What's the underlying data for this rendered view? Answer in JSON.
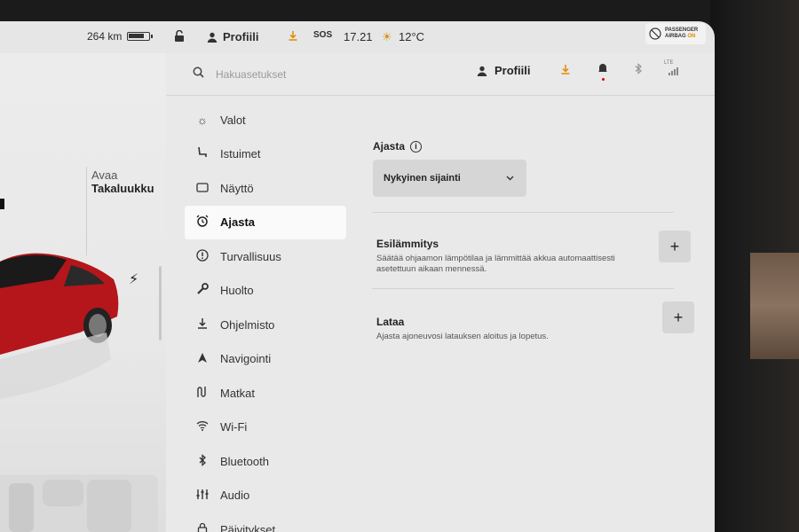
{
  "status_bar": {
    "range": "264 km",
    "profile": "Profiili",
    "sos": "SOS",
    "time": "17.21",
    "temperature": "12°C",
    "airbag_line1": "PASSENGER",
    "airbag_line2": "AIRBAG",
    "airbag_state": "ON"
  },
  "car_panel": {
    "trunk_open": "Avaa",
    "trunk_label": "Takaluukku"
  },
  "settings": {
    "search_placeholder": "Hakuasetukset",
    "header_profile": "Profiili",
    "lte": "LTE",
    "menu": [
      {
        "label": "Valot",
        "icon": "light-icon"
      },
      {
        "label": "Istuimet",
        "icon": "seat-icon"
      },
      {
        "label": "Näyttö",
        "icon": "display-icon"
      },
      {
        "label": "Ajasta",
        "icon": "alarm-clock-icon"
      },
      {
        "label": "Turvallisuus",
        "icon": "warning-circle-icon"
      },
      {
        "label": "Huolto",
        "icon": "wrench-icon"
      },
      {
        "label": "Ohjelmisto",
        "icon": "download-icon"
      },
      {
        "label": "Navigointi",
        "icon": "navigation-arrow-icon"
      },
      {
        "label": "Matkat",
        "icon": "trips-icon"
      },
      {
        "label": "Wi-Fi",
        "icon": "wifi-icon"
      },
      {
        "label": "Bluetooth",
        "icon": "bluetooth-icon"
      },
      {
        "label": "Audio",
        "icon": "equalizer-icon"
      },
      {
        "label": "Päivitykset",
        "icon": "lock-icon"
      }
    ],
    "active_menu": "Ajasta",
    "content": {
      "schedule_label": "Ajasta",
      "location_value": "Nykyinen sijainti",
      "preheat_title": "Esilämmitys",
      "preheat_desc": "Säätää ohjaamon lämpötilaa ja lämmittää akkua automaattisesti asetettuun aikaan mennessä.",
      "charge_title": "Lataa",
      "charge_desc": "Ajasta ajoneuvosi latauksen aloitus ja lopetus."
    }
  }
}
